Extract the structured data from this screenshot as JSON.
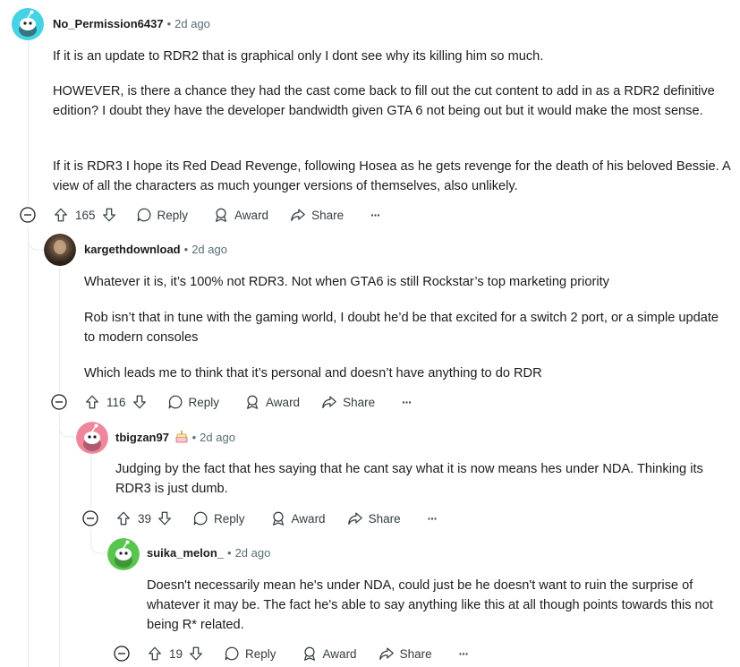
{
  "colors": {
    "avatar_cyan": "#46d3e6",
    "avatar_pink": "#f0869b",
    "avatar_green": "#58c64e",
    "text_secondary": "#576f76"
  },
  "comments": [
    {
      "username": "No_Permission6437",
      "time": "2d ago",
      "avatar": "snoo-cyan-avatar",
      "paragraphs": [
        "If it is an update to RDR2 that is graphical only I dont see why its killing him so much.",
        "HOWEVER, is there a chance they had the cast come back to fill out the cut content to add in as a RDR2 definitive edition? I doubt they have the developer bandwidth given GTA 6 not being out but it would make the most sense.",
        "If it is RDR3 I hope its Red Dead Revenge, following Hosea as he gets revenge for the death of his beloved Bessie. A view of all the characters as much younger versions of themselves, also unlikely."
      ],
      "votes": "165",
      "reply_label": "Reply",
      "award_label": "Award",
      "share_label": "Share",
      "more_label": "···"
    },
    {
      "username": "kargethdownload",
      "time": "2d ago",
      "avatar": "photo-avatar",
      "paragraphs": [
        "Whatever it is, it’s 100% not RDR3. Not when GTA6 is still Rockstar’s top marketing priority",
        "Rob isn’t that in tune with the gaming world, I doubt he’d be that excited for a switch 2 port, or a simple update to modern consoles",
        "Which leads me to think that it’s personal and doesn’t have anything to do RDR"
      ],
      "votes": "116",
      "reply_label": "Reply",
      "award_label": "Award",
      "share_label": "Share",
      "more_label": "···"
    },
    {
      "username": "tbigzan97",
      "time": "2d ago",
      "avatar": "snoo-pink-avatar",
      "flair": "cake-icon",
      "paragraphs": [
        "Judging by the fact that hes saying that he cant say what it is now means hes under NDA. Thinking its RDR3 is just dumb."
      ],
      "votes": "39",
      "reply_label": "Reply",
      "award_label": "Award",
      "share_label": "Share",
      "more_label": "···"
    },
    {
      "username": "suika_melon_",
      "time": "2d ago",
      "avatar": "snoo-green-avatar",
      "paragraphs": [
        "Doesn't necessarily mean he's under NDA, could just be he doesn't want to ruin the surprise of whatever it may be. The fact he's able to say anything like this at all though points towards this not being R* related."
      ],
      "votes": "19",
      "reply_label": "Reply",
      "award_label": "Award",
      "share_label": "Share",
      "more_label": "···"
    }
  ]
}
